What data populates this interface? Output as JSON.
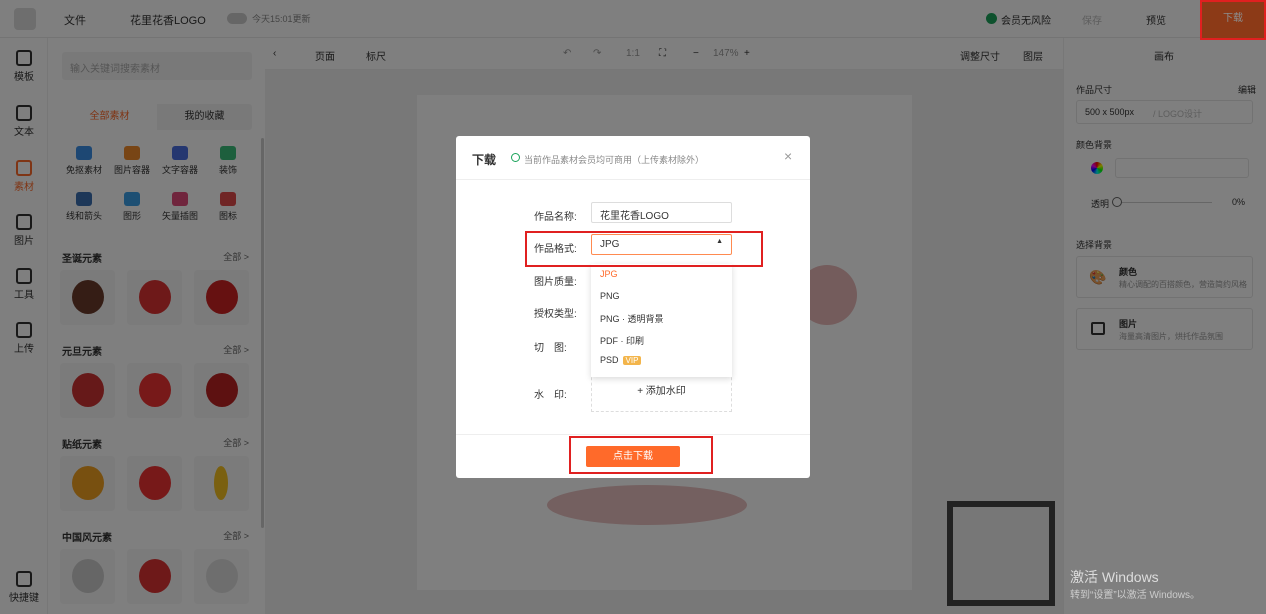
{
  "topbar": {
    "file": "文件",
    "title": "花里花香LOGO",
    "autosave": "今天15:01更新",
    "member": "会员无风险",
    "save": "保存",
    "preview": "预览",
    "download": "下载"
  },
  "rail": [
    {
      "label": "模板"
    },
    {
      "label": "文本"
    },
    {
      "label": "素材"
    },
    {
      "label": "图片"
    },
    {
      "label": "工具"
    },
    {
      "label": "上传"
    },
    {
      "label": "快捷键"
    }
  ],
  "panel": {
    "search_placeholder": "输入关键词搜索素材",
    "tabs": [
      "全部素材",
      "我的收藏"
    ],
    "categories": [
      "免抠素材",
      "图片容器",
      "文字容器",
      "装饰",
      "线和箭头",
      "图形",
      "矢量插图",
      "图标"
    ],
    "sections": [
      {
        "title": "圣诞元素",
        "more": "全部 >"
      },
      {
        "title": "元旦元素",
        "more": "全部 >"
      },
      {
        "title": "贴纸元素",
        "more": "全部 >"
      },
      {
        "title": "中国风元素",
        "more": "全部 >"
      }
    ]
  },
  "canvasbar": {
    "page": "页面",
    "ruler": "标尺",
    "ratio": "1:1",
    "zoom": "147%",
    "resize": "调整尺寸",
    "layers": "图层"
  },
  "right": {
    "title": "画布",
    "size_label": "作品尺寸",
    "edit": "编辑",
    "size": "500 x 500px",
    "size_type": "/ LOGO设计",
    "color_bg": "颜色背景",
    "opacity_label": "透明",
    "opacity": "0%",
    "choose_bg": "选择背景",
    "color_title": "颜色",
    "color_desc": "精心调配的百搭颜色，营造简约风格",
    "image_title": "图片",
    "image_desc": "海量高清图片，烘托作品氛围"
  },
  "modal": {
    "title": "下载",
    "notice": "当前作品素材会员均可商用（上传素材除外）",
    "name_label": "作品名称:",
    "name_value": "花里花香LOGO",
    "format_label": "作品格式:",
    "format_value": "JPG",
    "quality_label": "图片质量:",
    "license_label": "授权类型:",
    "cut_label": "切　图:",
    "watermark_label": "水　印:",
    "add_watermark": "+ 添加水印",
    "options": [
      "JPG",
      "PNG",
      "PNG · 透明背景",
      "PDF · 印刷",
      "PSD"
    ],
    "vip": "VIP",
    "submit": "点击下载"
  },
  "windows": {
    "line1": "激活 Windows",
    "line2": "转到“设置”以激活 Windows。"
  }
}
